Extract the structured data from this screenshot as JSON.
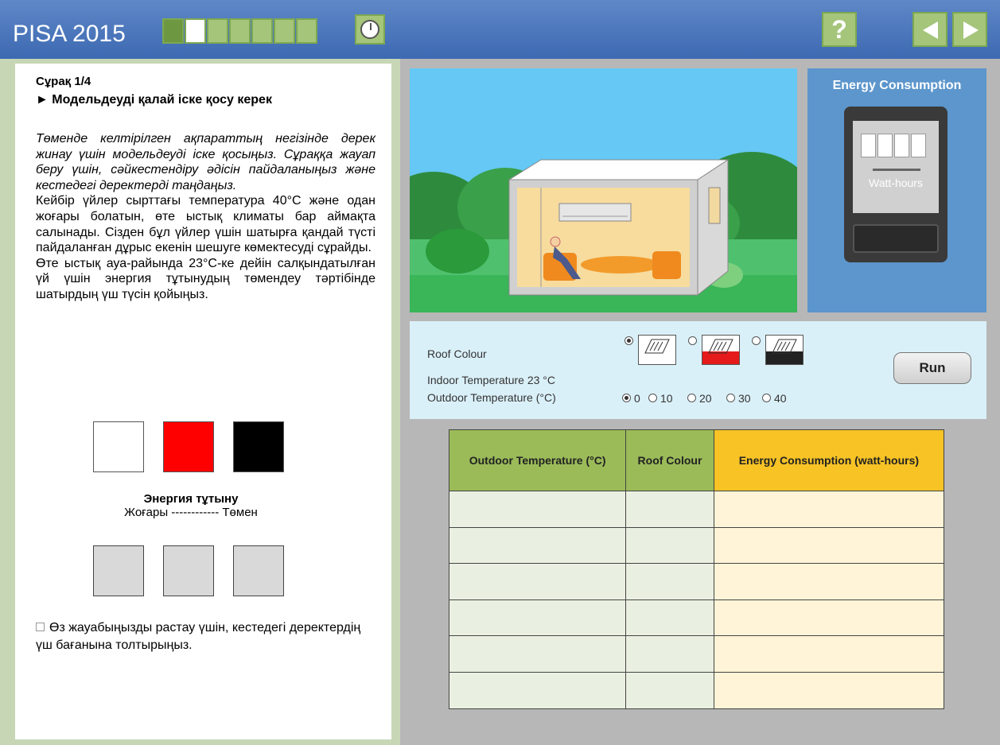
{
  "header": {
    "brand": "PISA 2015",
    "progress": {
      "segments": 7,
      "completed": 1,
      "current": 2
    },
    "icons": {
      "timer": "clock-icon",
      "help": "question-icon",
      "prev": "arrow-left-icon",
      "next": "arrow-right-icon"
    },
    "help_label": "?"
  },
  "question": {
    "number": "Сұрақ 1/4",
    "subtitle": "► Модельдеуді қалай іске қосу керек",
    "instruction": "Төменде келтірілген ақпараттың негізінде дерек жинау үшін модельдеуді іске қосыңыз. Сұраққа жауап беру үшін, сәйкестендіру әдісін пайдаланыңыз және кестедегі деректерді таңдаңыз.",
    "body": "Кейбір үйлер сырттағы температура 40°C және одан жоғары болатын, өте ыстық климаты бар аймақта салынады. Сізден бұл үйлер үшін шатырға қандай түсті пайдаланған дұрыс екенін шешуге көмектесуді сұрайды.",
    "task": "Өте ыстық ауа-райында 23°C-ке дейін салқындатылған үй үшін энергия тұтынудың төмендеу тәртібінде шатырдың үш түсін қойыңыз.",
    "swatches": [
      "#ffffff",
      "#ff0000",
      "#000000"
    ],
    "energy_title": "Энергия тұтыну",
    "energy_scale": "Жоғары ------------ Төмен",
    "confirm": "Өз жауабыңызды растау үшін, кестедегі деректердің үш бағанына толтырыңыз."
  },
  "meter": {
    "title": "Energy Consumption",
    "unit_label": "Watt-hours"
  },
  "controls": {
    "roof_colour_label": "Roof Colour",
    "indoor_label": "Indoor Temperature 23 °C",
    "outdoor_label": "Outdoor Temperature (°C)",
    "roof_options": [
      {
        "color": "#ffffff",
        "selected": true
      },
      {
        "color": "#e51a1a",
        "selected": false
      },
      {
        "color": "#222222",
        "selected": false
      }
    ],
    "temp_options": [
      "0",
      "10",
      "20",
      "30",
      "40"
    ],
    "temp_selected": "0",
    "run_label": "Run"
  },
  "table": {
    "headers": [
      "Outdoor Temperature (°C)",
      "Roof Colour",
      "Energy Consumption (watt-hours)"
    ],
    "rows": 6
  },
  "colors": {
    "header_bg": "#4a76bc",
    "progress_green": "#a4c57a",
    "scene_sky": "#66c8f4",
    "meter_panel": "#5c96cc",
    "table_green": "#9bbb59",
    "table_yellow": "#f7c325"
  }
}
